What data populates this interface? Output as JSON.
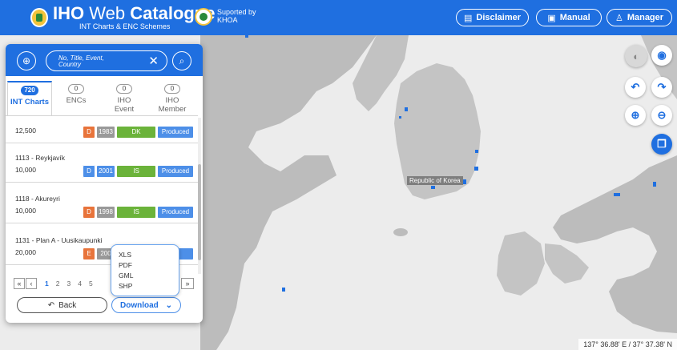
{
  "header": {
    "title_bold": "IHO",
    "title_rest": " Web ",
    "title_bold2": "Catalogue",
    "subtitle": "INT Charts & ENC Schemes",
    "supported_1": "Suported by",
    "supported_2": "KHOA",
    "buttons": {
      "disclaimer": "Disclaimer",
      "manual": "Manual",
      "manager": "Manager"
    }
  },
  "map": {
    "country_label": "Republic of Korea",
    "coords": "137° 36.88' E  /  37° 37.38' N"
  },
  "panel": {
    "search_placeholder": "No, Title, Event,\nCountry",
    "tabs": [
      {
        "label": "INT Charts",
        "count": "720"
      },
      {
        "label": "ENCs",
        "count": "0"
      },
      {
        "label": "IHO\nEvent",
        "count": "0"
      },
      {
        "label": "IHO\nMember",
        "count": "0"
      }
    ],
    "rows": [
      {
        "title": "",
        "scale": "12,500",
        "edition": "D",
        "year": "1983",
        "country": "DK",
        "status": "Produced"
      },
      {
        "title": "1113 - Reykjavík",
        "scale": "10,000",
        "edition": "D",
        "year": "2001",
        "country": "IS",
        "status": "Produced"
      },
      {
        "title": "1118 - Akureyri",
        "scale": "10,000",
        "edition": "D",
        "year": "1998",
        "country": "IS",
        "status": "Produced"
      },
      {
        "title": "1131 - Plan A - Uusikaupunki",
        "scale": "20,000",
        "edition": "E",
        "year": "200",
        "country": "",
        "status": "ed"
      }
    ],
    "pager": {
      "first": "«",
      "prev": "‹",
      "pages": [
        "1",
        "2",
        "3",
        "4",
        "5"
      ],
      "last": "»"
    },
    "back_label": "Back",
    "download_label": "Download",
    "download_options": [
      "XLS",
      "PDF",
      "GML",
      "SHP"
    ]
  }
}
